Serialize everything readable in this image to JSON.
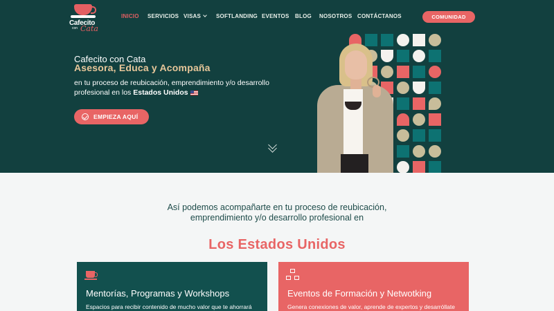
{
  "brand": {
    "line1": "Cafecito",
    "line2": "con",
    "line3": "Cata"
  },
  "nav": {
    "items": [
      "INICIO",
      "SERVICIOS",
      "VISAS",
      "SOFTLANDING",
      "EVENTOS",
      "BLOG",
      "NOSOTROS",
      "CONTÁCTANOS"
    ],
    "active": "INICIO",
    "cta": "COMUNIDAD"
  },
  "hero": {
    "name": "Cafecito con Cata",
    "tagline": "Asesora, Educa y Acompaña",
    "desc_part1": "en tu proceso de reubicación, emprendimiento y/o desarrollo profesional en los ",
    "desc_bold": "Estados Unidos",
    "button": "EMPIEZA AQUÍ"
  },
  "section": {
    "intro": "Así podemos acompañarte en tu proceso de reubicación, emprendimiento y/o desarrollo profesional en",
    "subtitle": "Los Estados Unidos"
  },
  "cards": [
    {
      "icon": "coffee-cup-icon",
      "title": "Mentorías, Programas y Workshops",
      "text": "Espacios para recibir contenido de mucho valor que te ahorrará"
    },
    {
      "icon": "network-icon",
      "title": "Eventos de Formación y Netwotking",
      "text": "Genera conexiones de valor, aprende de expertos y desarróllate"
    }
  ],
  "colors": {
    "hero_bg": "#12403f",
    "coral": "#e86565",
    "gold": "#e8c79a",
    "teal": "#0d7272"
  }
}
